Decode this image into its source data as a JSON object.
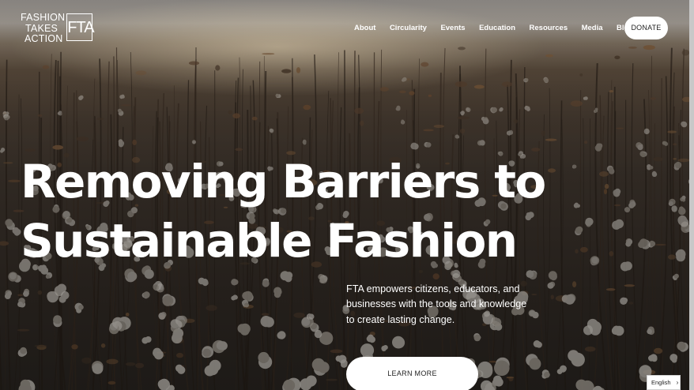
{
  "header": {
    "logo_words": [
      "FASHION",
      "TAKES",
      "ACTION"
    ],
    "logo_mark": "FTA",
    "nav": [
      "About",
      "Circularity",
      "Events",
      "Education",
      "Resources",
      "Media",
      "Blog"
    ],
    "donate_label": "DONATE"
  },
  "hero": {
    "headline_line1": "Removing Barriers to",
    "headline_line2": "Sustainable Fashion",
    "intro": "FTA empowers citizens, educators, and businesses with the tools and knowledge to create lasting change.",
    "cta_label": "LEARN MORE"
  },
  "language": {
    "selected": "English",
    "chevron_icon": "chevron-right-icon"
  },
  "colors": {
    "text": "#ffffff",
    "button_bg": "#ffffff",
    "button_text": "#222222"
  }
}
